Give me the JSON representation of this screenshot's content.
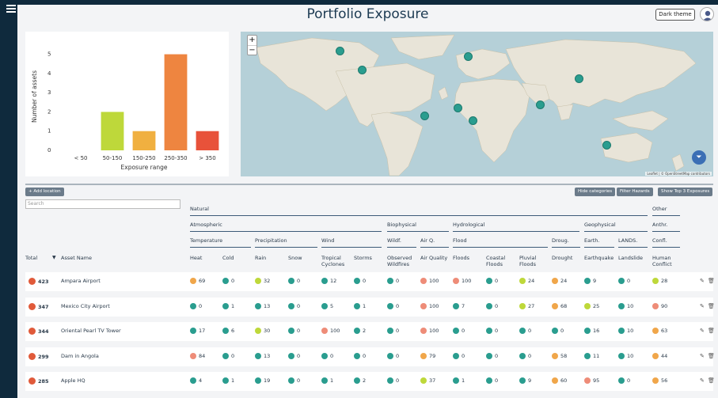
{
  "app": {
    "title": "Portfolio Exposure",
    "dark_theme_label": "Dark theme"
  },
  "chart_data": {
    "type": "bar",
    "categories": [
      "< 50",
      "50-150",
      "150-250",
      "250-350",
      "> 350"
    ],
    "values": [
      0,
      2,
      1,
      5,
      1
    ],
    "colors": [
      "#9acd32",
      "#bed83a",
      "#f0b040",
      "#ee8540",
      "#e8523a"
    ],
    "xlabel": "Exposure range",
    "ylabel": "Number of assets",
    "yticks": [
      "0",
      "1",
      "2",
      "3",
      "4",
      "5"
    ],
    "ylim": [
      0,
      5.6
    ]
  },
  "map": {
    "zoom_in": "+",
    "zoom_out": "−",
    "attribution": "Leaflet | © OpenStreetMap contributors",
    "filter_icon": "⏷"
  },
  "toolbar": {
    "add_location": "+ Add location",
    "hide_categories": "Hide categories",
    "filter_hazards": "Filter Hazards",
    "show_top3": "Show Top 3 Exposures",
    "search_placeholder": "Search"
  },
  "headers": {
    "natural": "Natural",
    "other": "Other",
    "atmospheric": "Atmospheric",
    "biophysical": "Biophysical",
    "hydrological": "Hydrological",
    "geophysical": "Geophysical",
    "anthr": "Anthr.",
    "temperature": "Temperature",
    "precipitation": "Precipitation",
    "wind": "Wind",
    "wildf": "Wildf.",
    "airq": "Air Q.",
    "flood": "Flood",
    "droug": "Droug.",
    "earth": "Earth.",
    "lands": "LANDS.",
    "confl": "Confl.",
    "total": "Total",
    "sort_icon": "▼",
    "asset_name": "Asset Name",
    "cols": [
      "Heat",
      "Cold",
      "Rain",
      "Snow",
      "Tropical Cyclones",
      "Storms",
      "Observed Wildfires",
      "Air Quality",
      "Floods",
      "Coastal Floods",
      "Pluvial Floods",
      "Drought",
      "Earthquake",
      "Landslide",
      "Human Conflict"
    ]
  },
  "colors": {
    "teal": "#2a9d8f",
    "yellowgreen": "#bed83a",
    "orange": "#f0a64a",
    "salmon": "#ee8c78",
    "red": "#e05a3a",
    "lime": "#c8dc4c"
  },
  "rows": [
    {
      "total": "423",
      "name": "Ampara Airport",
      "values": [
        "69",
        "0",
        "32",
        "0",
        "12",
        "0",
        "0",
        "100",
        "100",
        "0",
        "24",
        "24",
        "9",
        "0",
        "28"
      ],
      "colors": [
        "orange",
        "teal",
        "yellowgreen",
        "teal",
        "teal",
        "teal",
        "teal",
        "salmon",
        "salmon",
        "teal",
        "yellowgreen",
        "orange",
        "teal",
        "teal",
        "yellowgreen"
      ]
    },
    {
      "total": "347",
      "name": "Mexico City Airport",
      "values": [
        "0",
        "1",
        "13",
        "0",
        "5",
        "1",
        "0",
        "100",
        "7",
        "0",
        "27",
        "68",
        "25",
        "10",
        "90"
      ],
      "colors": [
        "teal",
        "teal",
        "teal",
        "teal",
        "teal",
        "teal",
        "teal",
        "salmon",
        "teal",
        "teal",
        "yellowgreen",
        "orange",
        "yellowgreen",
        "teal",
        "salmon"
      ]
    },
    {
      "total": "344",
      "name": "Oriental Pearl TV Tower",
      "values": [
        "17",
        "6",
        "30",
        "0",
        "100",
        "2",
        "0",
        "100",
        "0",
        "0",
        "0",
        "0",
        "16",
        "10",
        "63"
      ],
      "colors": [
        "teal",
        "teal",
        "yellowgreen",
        "teal",
        "salmon",
        "teal",
        "teal",
        "salmon",
        "teal",
        "teal",
        "teal",
        "teal",
        "teal",
        "teal",
        "orange"
      ]
    },
    {
      "total": "299",
      "name": "Dam in Angola",
      "values": [
        "84",
        "0",
        "13",
        "0",
        "0",
        "0",
        "0",
        "79",
        "0",
        "0",
        "0",
        "58",
        "11",
        "10",
        "44"
      ],
      "colors": [
        "salmon",
        "teal",
        "teal",
        "teal",
        "teal",
        "teal",
        "teal",
        "orange",
        "teal",
        "teal",
        "teal",
        "orange",
        "teal",
        "teal",
        "orange"
      ]
    },
    {
      "total": "285",
      "name": "Apple HQ",
      "values": [
        "4",
        "1",
        "19",
        "0",
        "1",
        "2",
        "0",
        "37",
        "1",
        "0",
        "9",
        "60",
        "95",
        "0",
        "56"
      ],
      "colors": [
        "teal",
        "teal",
        "teal",
        "teal",
        "teal",
        "teal",
        "teal",
        "yellowgreen",
        "teal",
        "teal",
        "teal",
        "orange",
        "salmon",
        "teal",
        "orange"
      ]
    }
  ],
  "actions": {
    "edit_icon": "✎",
    "delete_icon": "🗑"
  }
}
